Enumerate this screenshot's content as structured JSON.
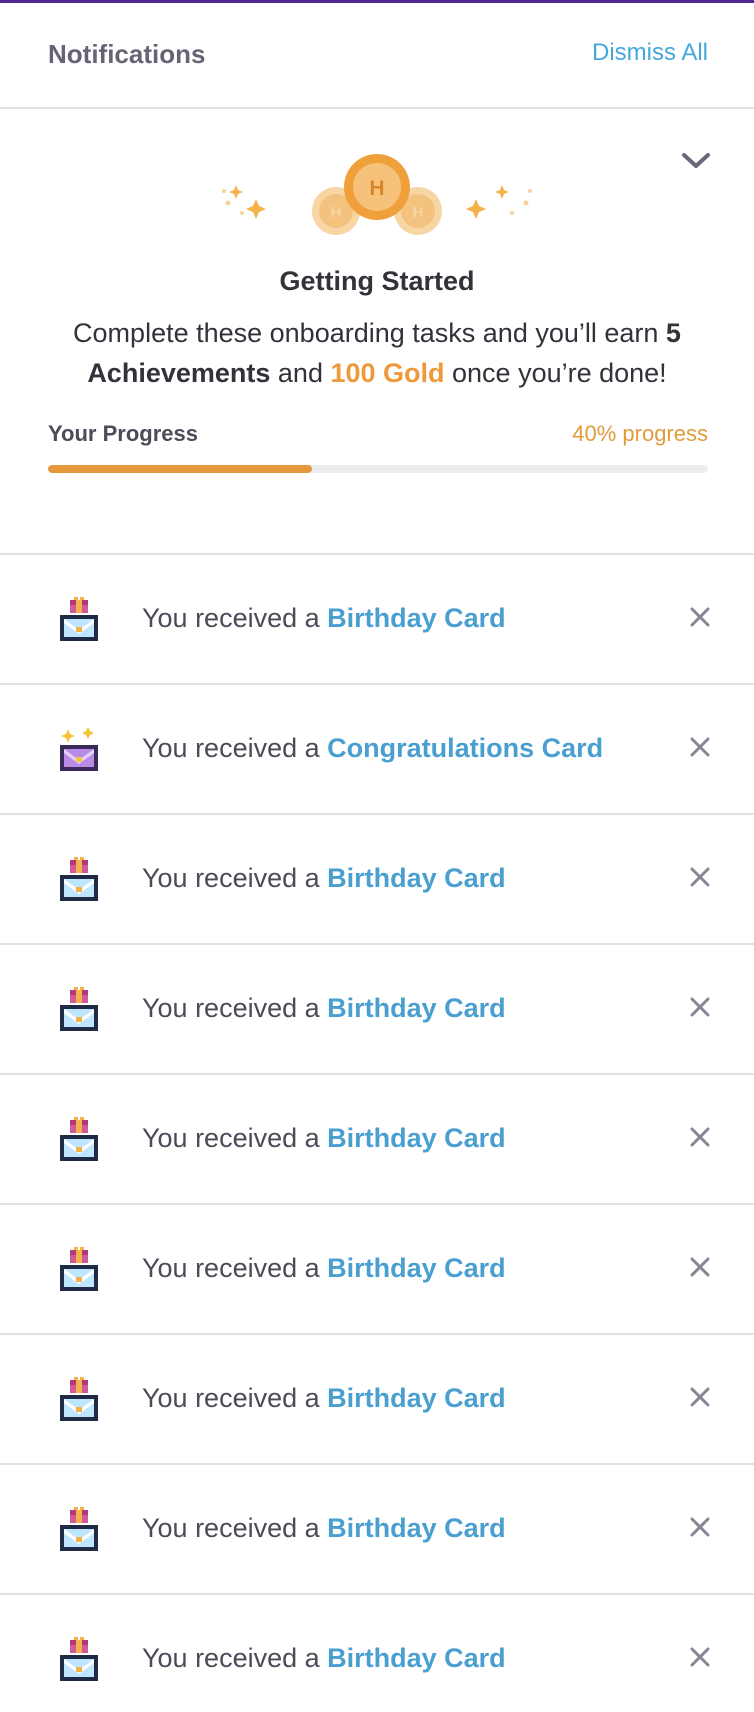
{
  "header": {
    "title": "Notifications",
    "dismiss_all": "Dismiss All"
  },
  "onboarding": {
    "title": "Getting Started",
    "text_before": "Complete these onboarding tasks and you’ll earn ",
    "achievements": "5 Achievements",
    "text_middle": " and ",
    "gold": "100 Gold",
    "text_after": " once you’re done!",
    "progress_label": "Your Progress",
    "progress_text": "40% progress",
    "progress_value": 0.4,
    "accent_color": "#e6983a",
    "coin_letter": "H"
  },
  "notifications": [
    {
      "prefix": "You received a ",
      "card": "Birthday Card",
      "icon": "birthday-card-icon"
    },
    {
      "prefix": "You received a ",
      "card": "Congratulations Card",
      "icon": "congratulations-card-icon"
    },
    {
      "prefix": "You received a ",
      "card": "Birthday Card",
      "icon": "birthday-card-icon"
    },
    {
      "prefix": "You received a ",
      "card": "Birthday Card",
      "icon": "birthday-card-icon"
    },
    {
      "prefix": "You received a ",
      "card": "Birthday Card",
      "icon": "birthday-card-icon"
    },
    {
      "prefix": "You received a ",
      "card": "Birthday Card",
      "icon": "birthday-card-icon"
    },
    {
      "prefix": "You received a ",
      "card": "Birthday Card",
      "icon": "birthday-card-icon"
    },
    {
      "prefix": "You received a ",
      "card": "Birthday Card",
      "icon": "birthday-card-icon"
    },
    {
      "prefix": "You received a ",
      "card": "Birthday Card",
      "icon": "birthday-card-icon"
    }
  ],
  "colors": {
    "link": "#46a7d9",
    "card_link": "#4a9fd1",
    "gold": "#ee9a3a",
    "header_accent": "#4f2a93"
  }
}
